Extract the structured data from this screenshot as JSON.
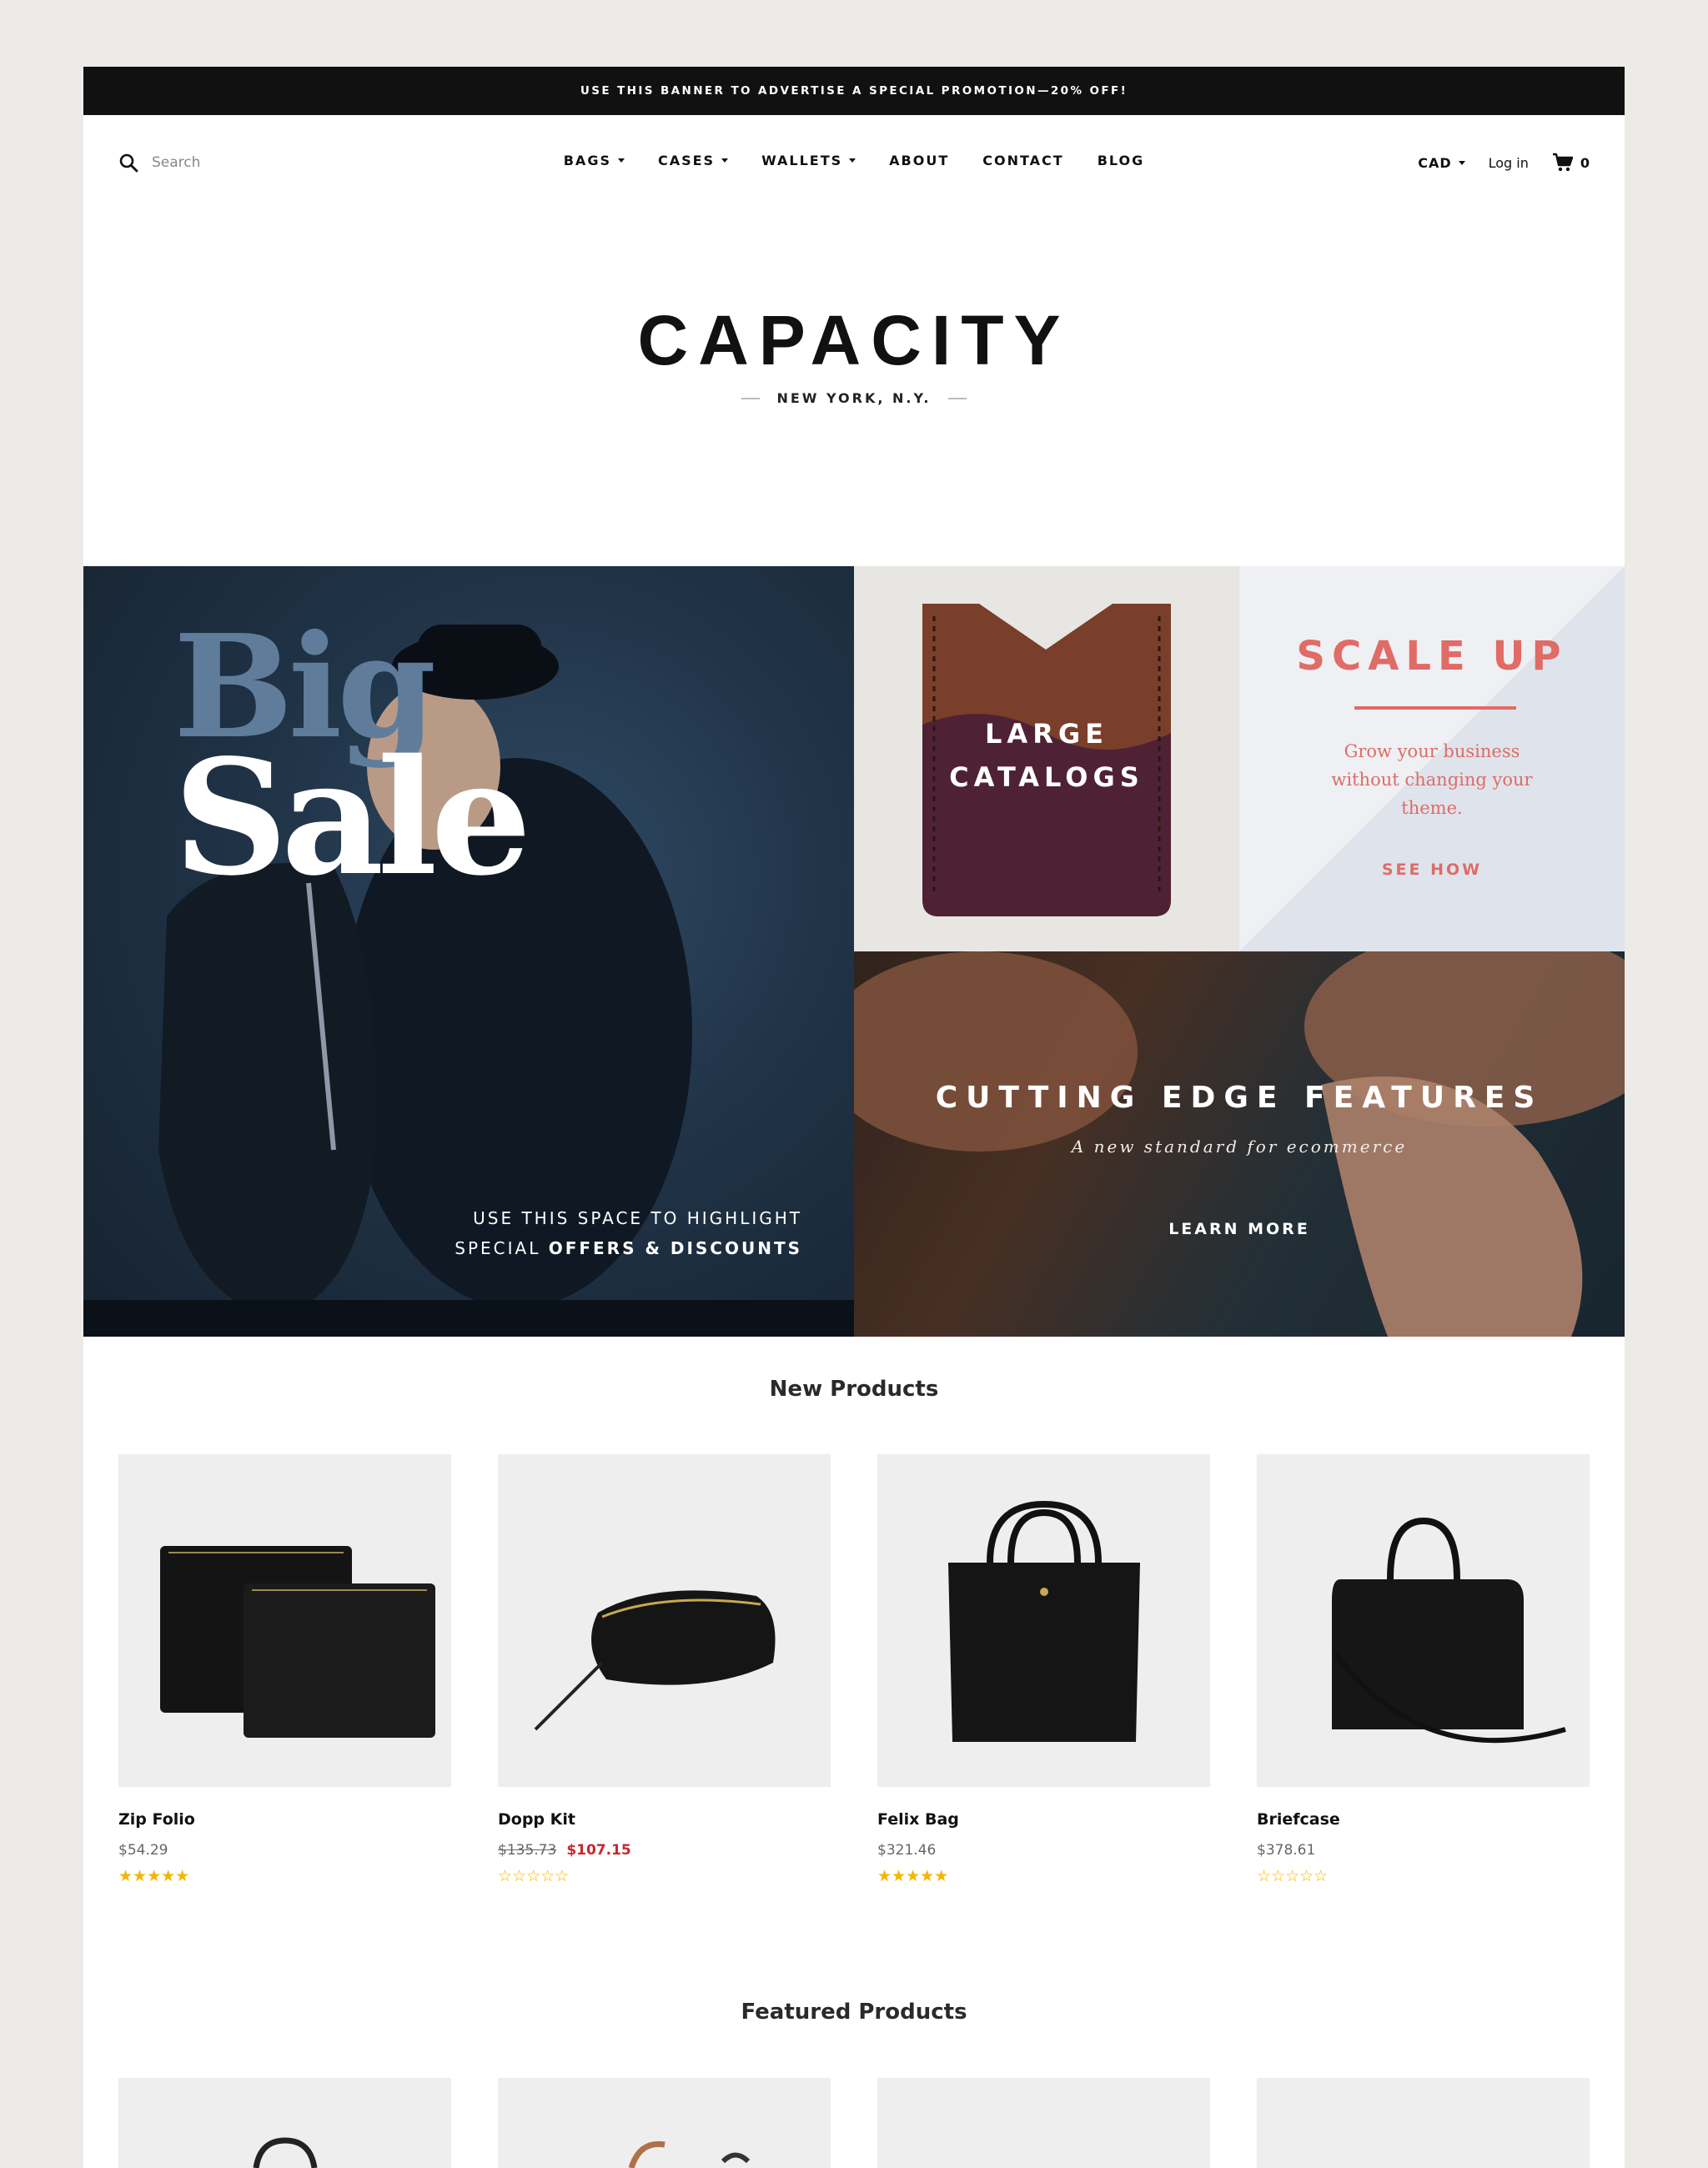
{
  "promo_banner": "USE THIS BANNER TO ADVERTISE A SPECIAL PROMOTION—20% OFF!",
  "search": {
    "placeholder": "Search",
    "icon": "search-icon"
  },
  "nav": {
    "items": [
      {
        "label": "BAGS",
        "dropdown": true
      },
      {
        "label": "CASES",
        "dropdown": true
      },
      {
        "label": "WALLETS",
        "dropdown": true
      },
      {
        "label": "ABOUT",
        "dropdown": false
      },
      {
        "label": "CONTACT",
        "dropdown": false
      },
      {
        "label": "BLOG",
        "dropdown": false
      }
    ]
  },
  "utils": {
    "currency": "CAD",
    "login": "Log in",
    "cart_count": "0",
    "cart_icon": "cart-icon"
  },
  "brand": {
    "logo": "CAPACITY",
    "tagline": "NEW YORK, N.Y."
  },
  "hero": {
    "big_sale": {
      "word1": "Big",
      "word2": "Sale",
      "caption_line1": "USE THIS SPACE TO HIGHLIGHT",
      "caption_line2_prefix": "SPECIAL ",
      "caption_line2_bold": "OFFERS & DISCOUNTS"
    },
    "catalogs": {
      "line1": "LARGE",
      "line2": "CATALOGS"
    },
    "scale_up": {
      "title": "SCALE UP",
      "text": "Grow your business without changing your theme.",
      "link": "SEE HOW"
    },
    "features": {
      "title": "CUTTING EDGE FEATURES",
      "subtitle": "A new standard for ecommerce",
      "link": "LEARN MORE"
    }
  },
  "new_products": {
    "title": "New Products",
    "items": [
      {
        "name": "Zip Folio",
        "price": "$54.29",
        "old_price": "",
        "sale_price": "",
        "rating": 5,
        "stars": "★★★★★"
      },
      {
        "name": "Dopp Kit",
        "price": "",
        "old_price": "$135.73",
        "sale_price": "$107.15",
        "rating": 0,
        "stars": "☆☆☆☆☆"
      },
      {
        "name": "Felix Bag",
        "price": "$321.46",
        "old_price": "",
        "sale_price": "",
        "rating": 5,
        "stars": "★★★★★"
      },
      {
        "name": "Briefcase",
        "price": "$378.61",
        "old_price": "",
        "sale_price": "",
        "rating": 0,
        "stars": "☆☆☆☆☆"
      }
    ]
  },
  "featured_products": {
    "title": "Featured Products"
  },
  "colors": {
    "accent_coral": "#e06b67",
    "sale_red": "#c8272c",
    "star_gold": "#f4b400",
    "banner_black": "#111111"
  }
}
